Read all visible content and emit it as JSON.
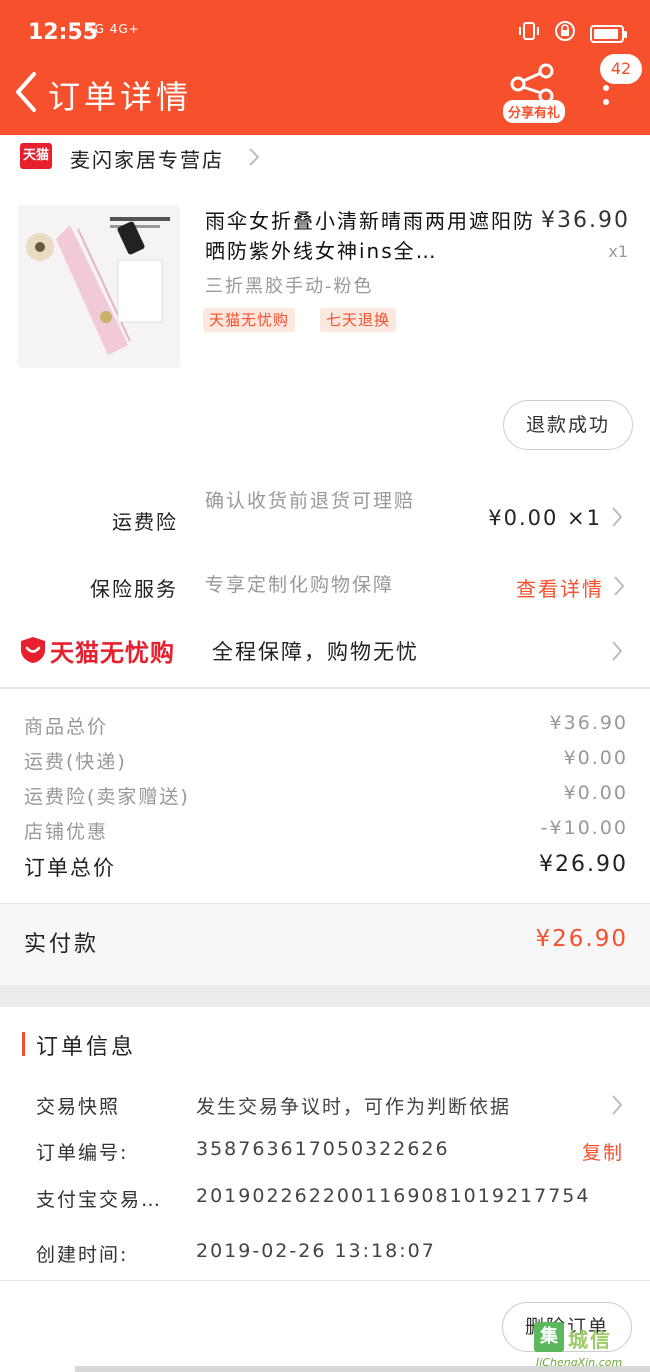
{
  "status_bar": {
    "time": "12:55",
    "signal": "4G 4G+"
  },
  "header": {
    "title": "订单详情",
    "share_label": "分享有礼",
    "badge_count": "42"
  },
  "store": {
    "logo_text": "天猫",
    "name": "麦闪家居专营店"
  },
  "product": {
    "title": "雨伞女折叠小清新晴雨两用遮阳防晒防紫外线女神ins全…",
    "price": "¥36.90",
    "quantity": "x1",
    "sku": "三折黑胶手动-粉色",
    "tags": [
      "天猫无忧购",
      "七天退换"
    ]
  },
  "refund_button": "退款成功",
  "freight_insurance": {
    "label": "运费险",
    "desc": "确认收货前退货可理赔",
    "value": "¥0.00 ×1"
  },
  "insurance_service": {
    "label": "保险服务",
    "desc": "专享定制化购物保障",
    "link": "查看详情"
  },
  "wuyou": {
    "logo_text": "天猫无忧购",
    "slogan": "全程保障，购物无忧"
  },
  "prices": [
    {
      "label": "商品总价",
      "value": "¥36.90"
    },
    {
      "label": "运费(快递)",
      "value": "¥0.00"
    },
    {
      "label": "运费险(卖家赠送)",
      "value": "¥0.00"
    },
    {
      "label": "店铺优惠",
      "value": "-¥10.00"
    }
  ],
  "order_total": {
    "label": "订单总价",
    "value": "¥26.90"
  },
  "paid": {
    "label": "实付款",
    "value": "¥26.90"
  },
  "order_info": {
    "title": "订单信息",
    "rows": [
      {
        "label": "交易快照",
        "value": "发生交易争议时，可作为判断依据"
      },
      {
        "label": "订单编号:",
        "value": "358763617050322626"
      },
      {
        "label": "支付宝交易…",
        "value": "2019022622001169081019217754"
      },
      {
        "label": "创建时间:",
        "value": "2019-02-26 13:18:07"
      }
    ],
    "copy_label": "复制"
  },
  "delete_button": "删除订单",
  "watermark": {
    "cn": "城信",
    "en": "JiChengXin.com",
    "box": "集"
  },
  "colors": {
    "accent": "#f7502d",
    "tmall_red": "#e8202d"
  }
}
